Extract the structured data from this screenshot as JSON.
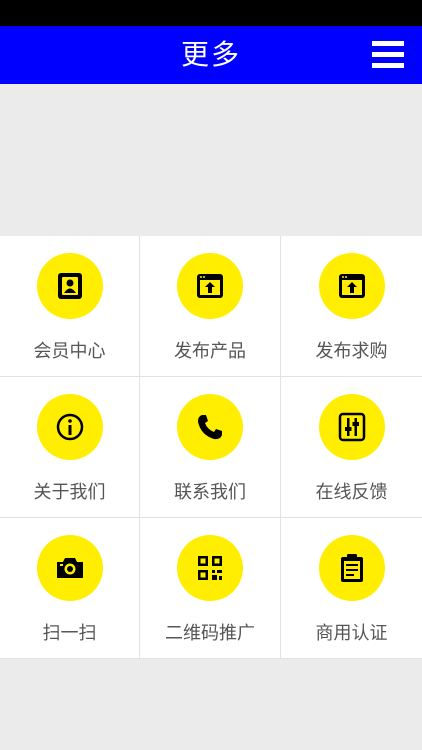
{
  "header": {
    "title": "更多",
    "menu_icon": "hamburger-menu-icon"
  },
  "colors": {
    "header_bg": "#0000ff",
    "icon_bg": "#ffee00",
    "icon_fg": "#000000",
    "page_bg": "#ebebeb"
  },
  "grid": {
    "items": [
      {
        "label": "会员中心",
        "icon": "member-card-icon"
      },
      {
        "label": "发布产品",
        "icon": "upload-window-icon"
      },
      {
        "label": "发布求购",
        "icon": "upload-window-icon"
      },
      {
        "label": "关于我们",
        "icon": "info-icon"
      },
      {
        "label": "联系我们",
        "icon": "phone-icon"
      },
      {
        "label": "在线反馈",
        "icon": "sliders-icon"
      },
      {
        "label": "扫一扫",
        "icon": "camera-icon"
      },
      {
        "label": "二维码推广",
        "icon": "qr-code-icon"
      },
      {
        "label": "商用认证",
        "icon": "clipboard-icon"
      }
    ]
  }
}
